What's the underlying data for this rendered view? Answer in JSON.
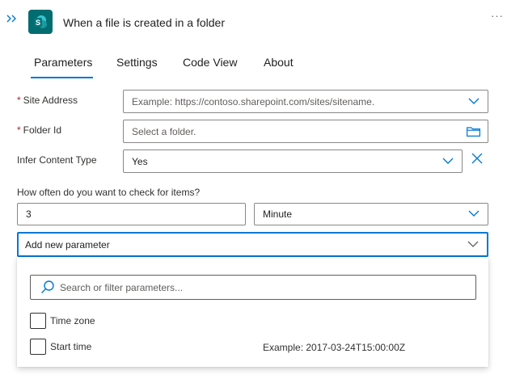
{
  "header": {
    "title": "When a file is created in a folder",
    "more_label": "···",
    "icon_letter": "S"
  },
  "tabs": [
    {
      "label": "Parameters",
      "active": true
    },
    {
      "label": "Settings",
      "active": false
    },
    {
      "label": "Code View",
      "active": false
    },
    {
      "label": "About",
      "active": false
    }
  ],
  "fields": {
    "site_address": {
      "label": "Site Address",
      "required": true,
      "placeholder": "Example: https://contoso.sharepoint.com/sites/sitename."
    },
    "folder_id": {
      "label": "Folder Id",
      "required": true,
      "placeholder": "Select a folder."
    },
    "infer_content_type": {
      "label": "Infer Content Type",
      "value": "Yes"
    }
  },
  "recurrence": {
    "question": "How often do you want to check for items?",
    "interval": "3",
    "frequency": "Minute"
  },
  "add_parameter": {
    "label": "Add new parameter",
    "search_placeholder": "Search or filter parameters...",
    "options": [
      {
        "label": "Time zone",
        "checked": false,
        "example": ""
      },
      {
        "label": "Start time",
        "checked": false,
        "example": "Example: 2017-03-24T15:00:00Z"
      }
    ]
  },
  "colors": {
    "accent": "#0078d4",
    "sharepoint_teal": "#036c70",
    "required": "#a4262c"
  },
  "icons": [
    "collapse-icon",
    "sharepoint-icon",
    "more-icon",
    "chevron-down-icon",
    "folder-icon",
    "clear-icon",
    "search-icon"
  ]
}
